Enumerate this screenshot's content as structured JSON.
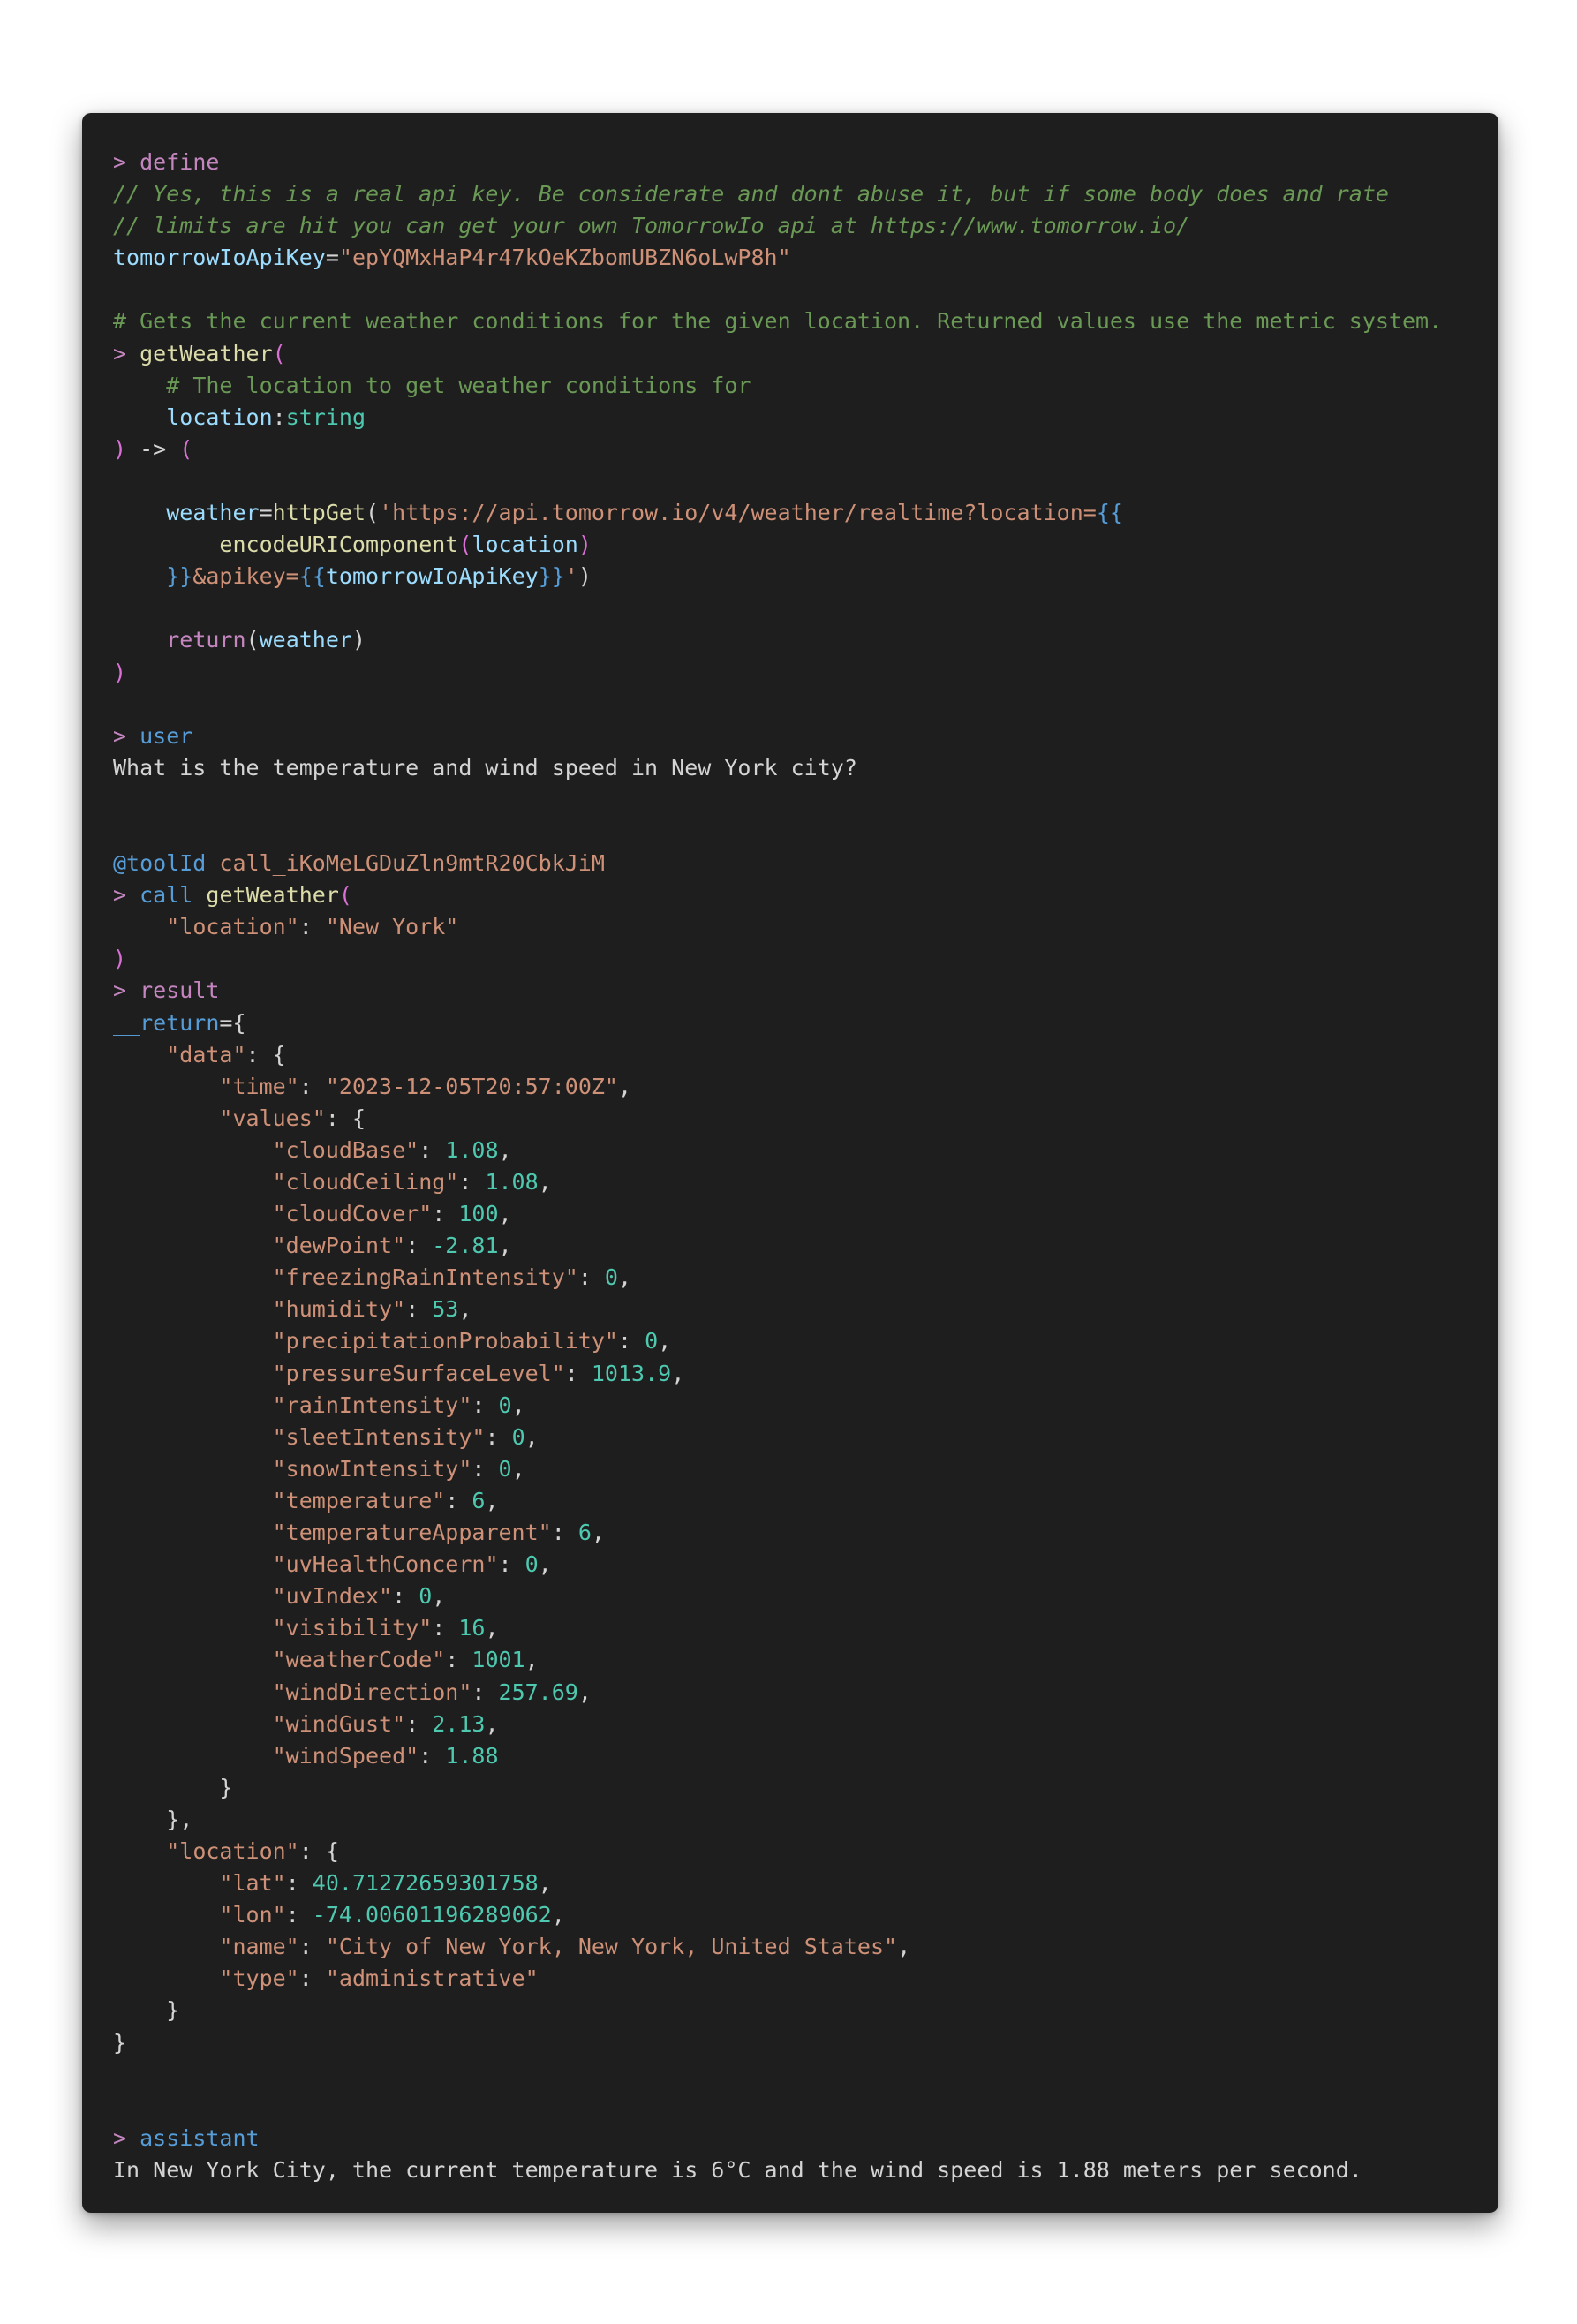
{
  "document": {
    "define_header": "define",
    "comment_1": "// Yes, this is a real api key. Be considerate and dont abuse it, but if some body does and rate",
    "comment_2": "// limits are hit you can get your own TomorrowIo api at https://www.tomorrow.io/",
    "api_key_name": "tomorrowIoApiKey",
    "api_key_value": "\"epYQMxHaP4r47kOeKZbomUBZN6oLwP8h\"",
    "fn_doc_comment": "# Gets the current weather conditions for the given location. Returned values use the metric system.",
    "fn_name": "getWeather",
    "param_comment": "# The location to get weather conditions for",
    "param_name": "location",
    "param_type": "string",
    "weather_var": "weather",
    "http_fn": "httpGet",
    "url_start": "'https://api.tomorrow.io/v4/weather/realtime?location=",
    "encode_fn": "encodeURIComponent",
    "encode_arg": "location",
    "url_apikey": "&apikey=",
    "url_apikey_var": "tomorrowIoApiKey",
    "url_end": "'",
    "return_kw": "return",
    "return_arg": "weather",
    "user_header": "user",
    "user_message": "What is the temperature and wind speed in New York city?",
    "tool_id_label": "@toolId",
    "tool_id_value": "call_iKoMeLGDuZln9mtR20CbkJiM",
    "call_kw": "call",
    "call_fn": "getWeather",
    "call_arg_key": "\"location\"",
    "call_arg_value": "\"New York\"",
    "result_header": "result",
    "return_var": "__return",
    "json": {
      "data_key": "\"data\"",
      "time_key": "\"time\"",
      "time_value": "\"2023-12-05T20:57:00Z\"",
      "values_key": "\"values\"",
      "values": [
        {
          "key": "\"cloudBase\"",
          "value": "1.08",
          "comma": ","
        },
        {
          "key": "\"cloudCeiling\"",
          "value": "1.08",
          "comma": ","
        },
        {
          "key": "\"cloudCover\"",
          "value": "100",
          "comma": ","
        },
        {
          "key": "\"dewPoint\"",
          "value": "-2.81",
          "comma": ","
        },
        {
          "key": "\"freezingRainIntensity\"",
          "value": "0",
          "comma": ","
        },
        {
          "key": "\"humidity\"",
          "value": "53",
          "comma": ","
        },
        {
          "key": "\"precipitationProbability\"",
          "value": "0",
          "comma": ","
        },
        {
          "key": "\"pressureSurfaceLevel\"",
          "value": "1013.9",
          "comma": ","
        },
        {
          "key": "\"rainIntensity\"",
          "value": "0",
          "comma": ","
        },
        {
          "key": "\"sleetIntensity\"",
          "value": "0",
          "comma": ","
        },
        {
          "key": "\"snowIntensity\"",
          "value": "0",
          "comma": ","
        },
        {
          "key": "\"temperature\"",
          "value": "6",
          "comma": ","
        },
        {
          "key": "\"temperatureApparent\"",
          "value": "6",
          "comma": ","
        },
        {
          "key": "\"uvHealthConcern\"",
          "value": "0",
          "comma": ","
        },
        {
          "key": "\"uvIndex\"",
          "value": "0",
          "comma": ","
        },
        {
          "key": "\"visibility\"",
          "value": "16",
          "comma": ","
        },
        {
          "key": "\"weatherCode\"",
          "value": "1001",
          "comma": ","
        },
        {
          "key": "\"windDirection\"",
          "value": "257.69",
          "comma": ","
        },
        {
          "key": "\"windGust\"",
          "value": "2.13",
          "comma": ","
        },
        {
          "key": "\"windSpeed\"",
          "value": "1.88",
          "comma": ""
        }
      ],
      "location_key": "\"location\"",
      "lat_key": "\"lat\"",
      "lat_value": "40.71272659301758",
      "lon_key": "\"lon\"",
      "lon_value": "-74.00601196289062",
      "name_key": "\"name\"",
      "name_value": "\"City of New York, New York, United States\"",
      "type_key": "\"type\"",
      "type_value": "\"administrative\""
    },
    "assistant_header": "assistant",
    "assistant_message": "In New York City, the current temperature is 6°C and the wind speed is 1.88 meters per second."
  },
  "colors": {
    "background": "#1e1e1e",
    "keyword": "#c586c0",
    "function": "#dcdcaa",
    "string": "#ce9178",
    "number": "#b5cea8",
    "comment": "#6a9955",
    "variable": "#9cdcfe",
    "type": "#4ec9b0",
    "role": "#569cd6"
  }
}
